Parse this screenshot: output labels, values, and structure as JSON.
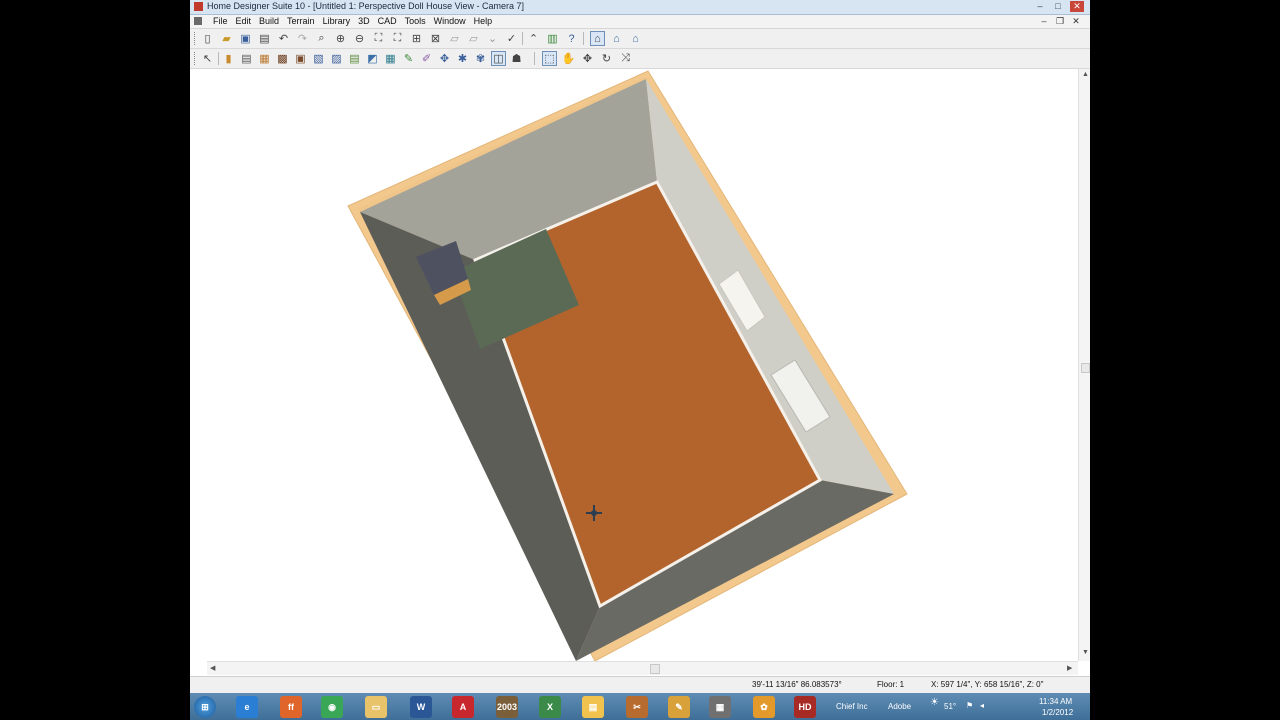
{
  "window": {
    "title": "Home Designer Suite 10 - [Untitled 1: Perspective Doll House View - Camera 7]",
    "minimize": "–",
    "maximize": "□",
    "close": "✕"
  },
  "menu": {
    "items": [
      "File",
      "Edit",
      "Build",
      "Terrain",
      "Library",
      "3D",
      "CAD",
      "Tools",
      "Window",
      "Help"
    ]
  },
  "status": {
    "measure": "39'-11 13/16\" 86.083573°",
    "floor": "Floor: 1",
    "coords": "X: 597 1/4\", Y: 658 15/16\", Z: 0\""
  },
  "taskbar": {
    "start_icon": "windows-start-icon",
    "apps": [
      {
        "name": "internet-explorer-icon",
        "label": "e",
        "color": "#2a7fd4"
      },
      {
        "name": "firefox-icon",
        "label": "ff",
        "color": "#e0652a"
      },
      {
        "name": "chrome-icon",
        "label": "◉",
        "color": "#3aa757"
      },
      {
        "name": "file-explorer-icon",
        "label": "▭",
        "color": "#e8c36a"
      },
      {
        "name": "word-icon",
        "label": "W",
        "color": "#2b5797"
      },
      {
        "name": "acrobat-icon",
        "label": "A",
        "color": "#c8272d"
      },
      {
        "name": "library-app-icon",
        "label": "2003",
        "color": "#7b5e3a"
      },
      {
        "name": "excel-icon",
        "label": "X",
        "color": "#3b8a4a"
      },
      {
        "name": "explorer-folder-icon",
        "label": "▤",
        "color": "#f2c24f"
      },
      {
        "name": "tool-app-icon",
        "label": "✂",
        "color": "#b86b2f"
      },
      {
        "name": "paint-app-icon",
        "label": "✎",
        "color": "#d9a13a"
      },
      {
        "name": "printer-app-icon",
        "label": "▦",
        "color": "#707070"
      },
      {
        "name": "flower-app-icon",
        "label": "✿",
        "color": "#e39a2b"
      },
      {
        "name": "home-designer-icon",
        "label": "HD",
        "color": "#a82a25"
      }
    ],
    "tray": {
      "chief": "Chief Inc",
      "adobe": "Adobe",
      "temp": "51°",
      "time": "11:34 AM",
      "date": "1/2/2012"
    }
  },
  "colors": {
    "floor": "#b3642c",
    "tile": "#5a6a55",
    "wall_top": "#f2c88d",
    "wall_back": "#a3a39a",
    "wall_right": "#cfcfc8",
    "wall_left": "#5d5d58"
  }
}
